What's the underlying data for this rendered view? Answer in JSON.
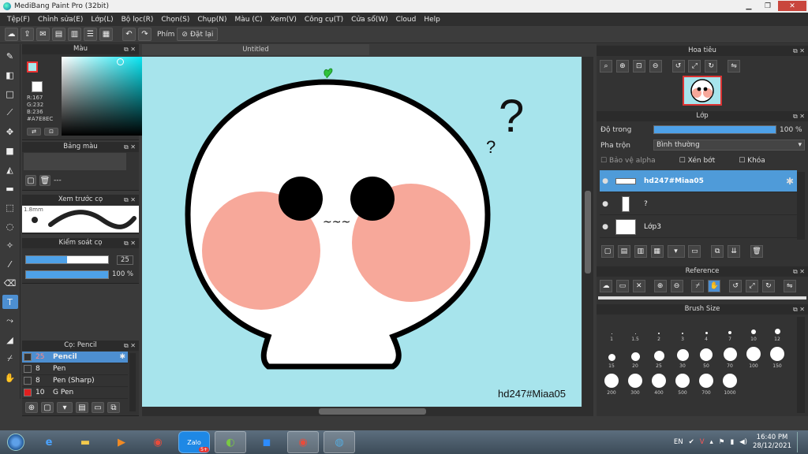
{
  "window": {
    "title": "MediBang Paint Pro (32bit)"
  },
  "menu": [
    "Tệp(F)",
    "Chỉnh sửa(E)",
    "Lớp(L)",
    "Bộ lọc(R)",
    "Chọn(S)",
    "Chụp(N)",
    "Màu (C)",
    "Xem(V)",
    "Công cụ(T)",
    "Cửa sổ(W)",
    "Cloud",
    "Help"
  ],
  "toolbar": {
    "key_label": "Phím",
    "reset_label": "Đặt lại"
  },
  "color_panel": {
    "title": "Màu",
    "r": "R:167",
    "g": "G:232",
    "b": "B:236",
    "hex": "#A7E8EC",
    "fg_color": "#A7E8EC"
  },
  "palette_panel": {
    "title": "Bảng màu",
    "value": "---"
  },
  "preview_panel": {
    "title": "Xem trước cọ",
    "size": "1.8mm"
  },
  "control_panel": {
    "title": "Kiểm soát cọ",
    "size_value": "25",
    "size_level": 0.5,
    "opacity_value": "100 %",
    "opacity_level": 1.0
  },
  "brush_panel": {
    "title": "Cọ: Pencil",
    "items": [
      {
        "size": "25",
        "name": "Pencil",
        "color": "#333333",
        "selected": true
      },
      {
        "size": "8",
        "name": "Pen",
        "color": "#333333"
      },
      {
        "size": "8",
        "name": "Pen (Sharp)",
        "color": "#333333"
      },
      {
        "size": "10",
        "name": "G Pen",
        "color": "#e02020"
      }
    ]
  },
  "document": {
    "tab": "Untitled",
    "artwork": {
      "background": "#A7E4EC",
      "q_big": "?",
      "q_small": "?",
      "emote": "~~~",
      "signature": "hd247#Miaa05"
    }
  },
  "navigator_panel": {
    "title": "Hoa tiêu"
  },
  "layer_panel": {
    "title": "Lớp",
    "opacity_label": "Độ trong",
    "opacity_value": "100 %",
    "opacity_level": 1.0,
    "blend_label": "Pha trộn",
    "blend_value": "Bình thường",
    "protect_alpha": "Bảo vệ alpha",
    "clipping": "Xén bớt",
    "lock": "Khóa",
    "layers": [
      {
        "name": "hd247#Miaa05",
        "selected": true
      },
      {
        "name": "?"
      },
      {
        "name": "Lớp3"
      }
    ]
  },
  "reference_panel": {
    "title": "Reference"
  },
  "brush_size_panel": {
    "title": "Brush Size",
    "sizes": [
      "1",
      "1.5",
      "2",
      "3",
      "4",
      "7",
      "10",
      "12",
      "15",
      "20",
      "25",
      "30",
      "50",
      "70",
      "100",
      "150",
      "200",
      "300",
      "400",
      "500",
      "700",
      "1000"
    ]
  },
  "taskbar": {
    "lang": "EN",
    "time": "16:40 PM",
    "date": "28/12/2021",
    "zalo_badge": "5+"
  }
}
